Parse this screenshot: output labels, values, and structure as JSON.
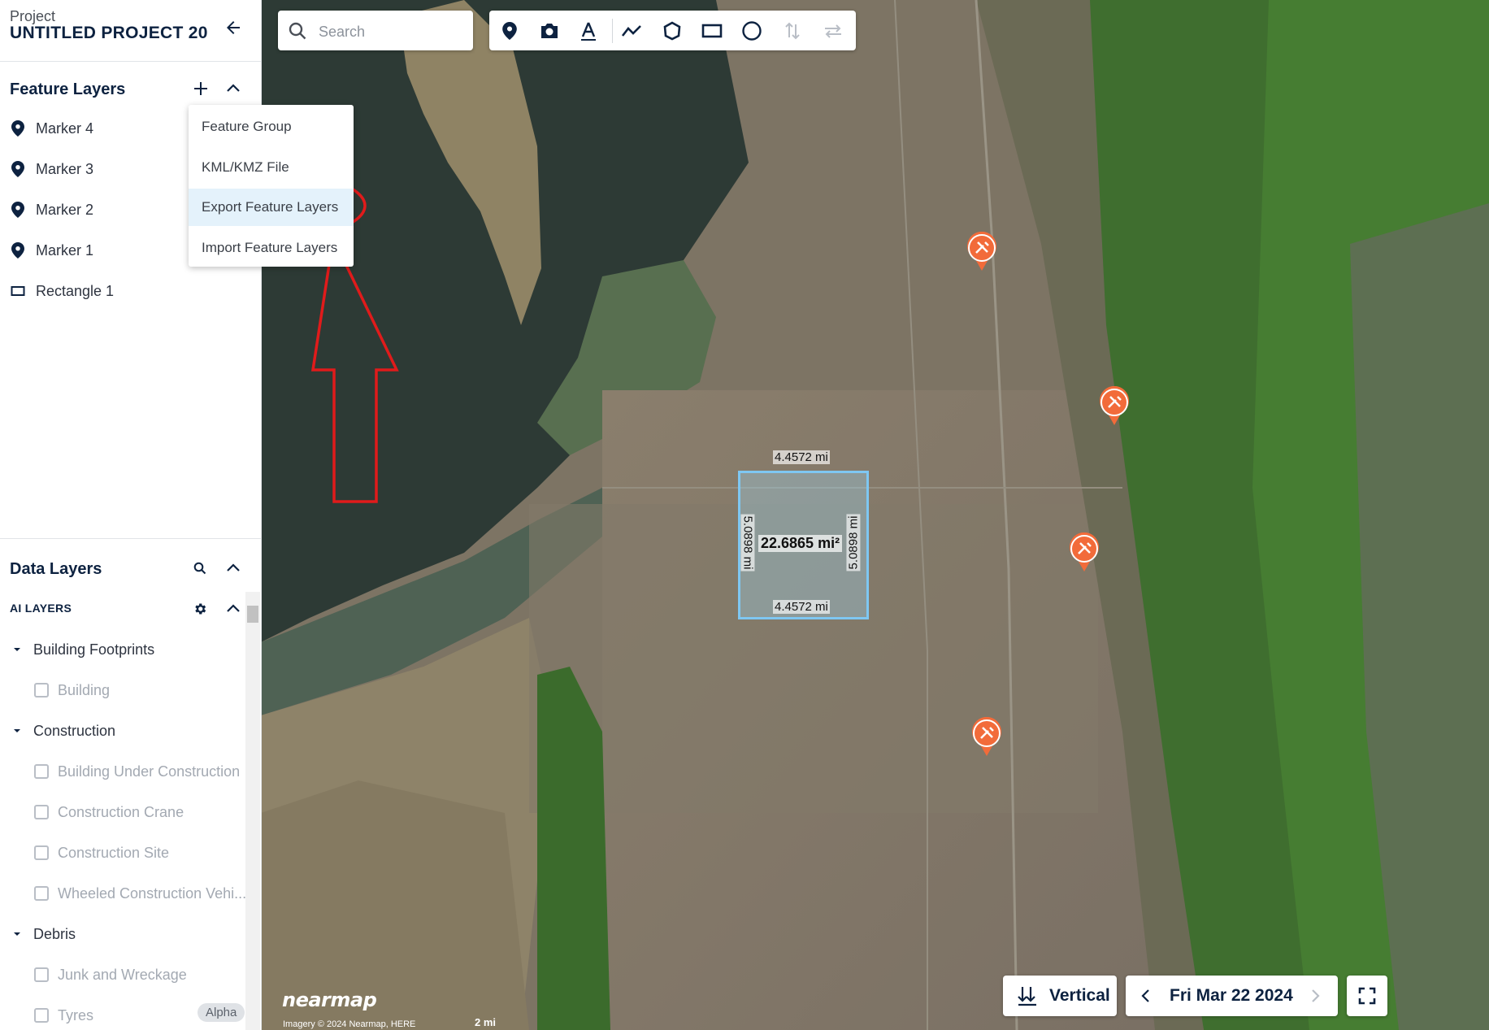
{
  "project": {
    "label": "Project",
    "title": "UNTITLED PROJECT 20"
  },
  "feature_layers": {
    "title": "Feature Layers",
    "items": [
      {
        "label": "Marker 4",
        "icon": "map-pin-icon"
      },
      {
        "label": "Marker 3",
        "icon": "map-pin-icon"
      },
      {
        "label": "Marker 2",
        "icon": "map-pin-icon"
      },
      {
        "label": "Marker 1",
        "icon": "map-pin-icon"
      },
      {
        "label": "Rectangle 1",
        "icon": "rectangle-icon"
      }
    ]
  },
  "add_menu": {
    "items": [
      {
        "label": "Feature Group"
      },
      {
        "label": "KML/KMZ File"
      },
      {
        "label": "Export Feature Layers",
        "highlighted": true
      },
      {
        "label": "Import Feature Layers"
      }
    ]
  },
  "data_layers": {
    "title": "Data Layers",
    "ai_layers_heading": "AI LAYERS",
    "groups": [
      {
        "label": "Building Footprints",
        "expanded": true,
        "children": [
          "Building"
        ]
      },
      {
        "label": "Construction",
        "expanded": true,
        "children": [
          "Building Under Construction",
          "Construction Crane",
          "Construction Site",
          "Wheeled Construction Vehi..."
        ]
      },
      {
        "label": "Debris",
        "expanded": true,
        "children": [
          "Junk and Wreckage",
          "Tyres"
        ]
      }
    ],
    "badge": "Alpha"
  },
  "search": {
    "placeholder": "Search"
  },
  "toolbar": {
    "tools": [
      "map-pin-icon",
      "camera-icon",
      "text-annotation-icon",
      "polyline-icon",
      "polygon-icon",
      "rectangle-icon",
      "circle-icon",
      "height-measure-icon",
      "swap-direction-icon"
    ]
  },
  "measurement": {
    "top": "4.4572 mi",
    "bottom": "4.4572 mi",
    "left": "5.0898 mi",
    "right": "5.0898 mi",
    "area": "22.6865 mi²"
  },
  "bottom_controls": {
    "view_mode": "Vertical",
    "date": "Fri Mar 22 2024"
  },
  "map_footer": {
    "logo": "nearmap",
    "attribution": "Imagery © 2024 Nearmap, HERE",
    "scale": "2 mi"
  },
  "colors": {
    "accent": "#0d2240",
    "marker": "#f26b3a",
    "annotation": "#e01b1b",
    "selection": "#7ec7f2",
    "menu_highlight": "#e4f2fb"
  }
}
